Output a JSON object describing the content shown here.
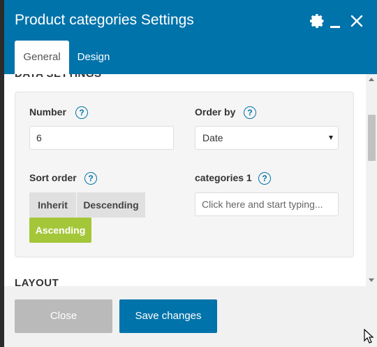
{
  "window": {
    "title": "Product categories Settings"
  },
  "tabs": [
    {
      "label": "General"
    },
    {
      "label": "Design"
    }
  ],
  "sections": {
    "data_settings": "DATA SETTINGS",
    "layout": "LAYOUT"
  },
  "fields": {
    "number": {
      "label": "Number",
      "value": "6"
    },
    "order_by": {
      "label": "Order by",
      "value": "Date"
    },
    "sort_order": {
      "label": "Sort order",
      "options": [
        "Inherit",
        "Descending",
        "Ascending"
      ],
      "selected": "Ascending"
    },
    "categories": {
      "label": "categories 1",
      "placeholder": "Click here and start typing..."
    }
  },
  "help_glyph": "?",
  "footer": {
    "close_label": "Close",
    "save_label": "Save changes"
  },
  "colors": {
    "header": "#0073aa",
    "accent_active": "#a4c639",
    "save": "#0073aa",
    "close": "#bababa"
  },
  "icons": [
    "gear-icon",
    "minimize-icon",
    "close-icon",
    "help-icon",
    "caret-down-icon",
    "mouse-cursor-icon"
  ]
}
